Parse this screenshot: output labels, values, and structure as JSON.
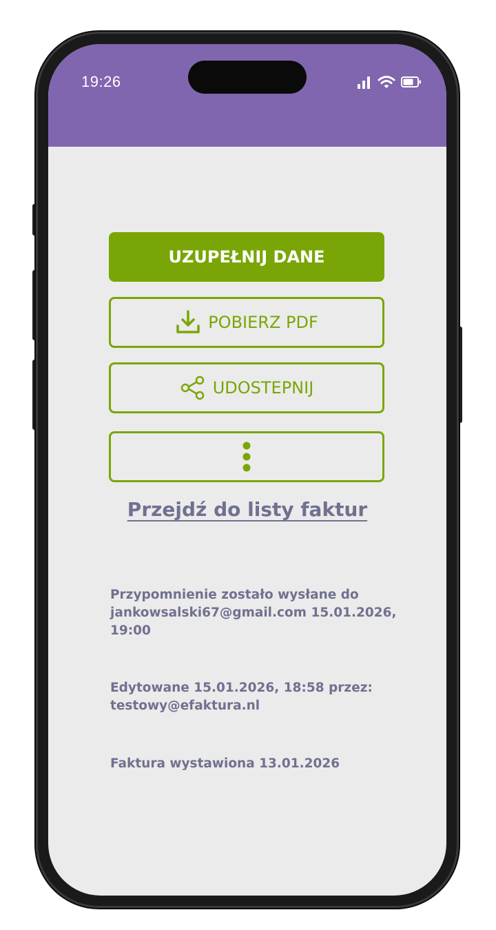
{
  "status_bar": {
    "time": "19:26",
    "icons": [
      "signal-icon",
      "wifi-icon",
      "battery-icon"
    ]
  },
  "actions": {
    "complete_data_label": "UZUPEŁNIJ DANE",
    "download_pdf_label": "POBIERZ PDF",
    "share_label": "UDOSTEPNIJ",
    "more_icon": "more-vertical-icon"
  },
  "links": {
    "invoice_list": "Przejdź do listy faktur"
  },
  "history": {
    "reminder": "Przypomnienie zostało wysłane do jankowsalski67@gmail.com 15.01.2026, 19:00",
    "edited": "Edytowane 15.01.2026, 18:58 przez: testowy@efaktura.nl",
    "issued": "Faktura wystawiona 13.01.2026"
  },
  "colors": {
    "header": "#8066ae",
    "accent": "#79a606",
    "text_muted": "#707090",
    "background": "#ebebeb"
  }
}
